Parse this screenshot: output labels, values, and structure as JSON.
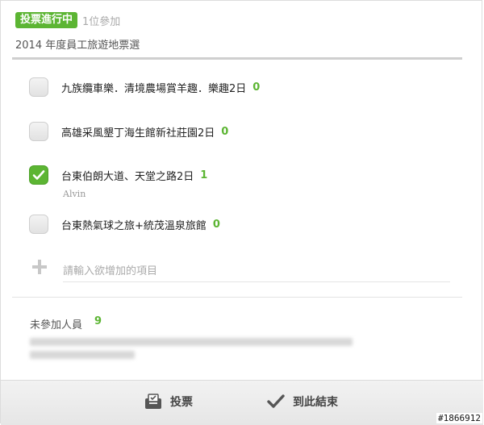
{
  "poll": {
    "status_badge": "投票進行中",
    "participant_count": "1位參加",
    "title": "2014 年度員工旅遊地票選"
  },
  "options": [
    {
      "label": "九族纜車樂．清境農場賞羊趣．樂趣2日",
      "count": "0",
      "checked": false
    },
    {
      "label": "高雄采風墾丁海生館新社莊園2日",
      "count": "0",
      "checked": false
    },
    {
      "label": "台東伯朗大道、天堂之路2日",
      "count": "1",
      "checked": true,
      "voter": "Alvin"
    },
    {
      "label": "台東熱氣球之旅+統茂溫泉旅館",
      "count": "0",
      "checked": false
    }
  ],
  "add_option": {
    "placeholder": "請輸入欲增加的項目",
    "value": ""
  },
  "not_voted": {
    "label": "未參加人員",
    "count": "9"
  },
  "footer": {
    "vote_label": "投票",
    "end_label": "到此結束"
  },
  "watermark": "#1866912",
  "colors": {
    "accent": "#5cb533",
    "divider": "#cfcfcf"
  },
  "icons": {
    "check": "check-icon",
    "plus": "plus-icon",
    "ballot": "ballot-box-icon",
    "end": "checkmark-icon"
  }
}
